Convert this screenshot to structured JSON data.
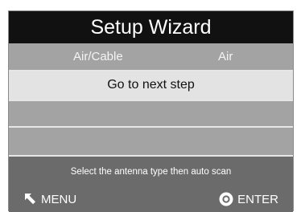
{
  "title": "Setup Wizard",
  "antenna": {
    "label": "Air/Cable",
    "value": "Air"
  },
  "next_step_label": "Go to next step",
  "hint": "Select the antenna type then auto scan",
  "footer": {
    "menu_label": "MENU",
    "menu_icon": "return-arrow-icon",
    "enter_label": "ENTER",
    "enter_icon": "ok-circle-icon"
  },
  "colors": {
    "title_bg": "#111111",
    "row_bg": "#a3a3a3",
    "selected_row_bg": "#e3e3e3",
    "footer_bg": "#6b6b6b"
  }
}
